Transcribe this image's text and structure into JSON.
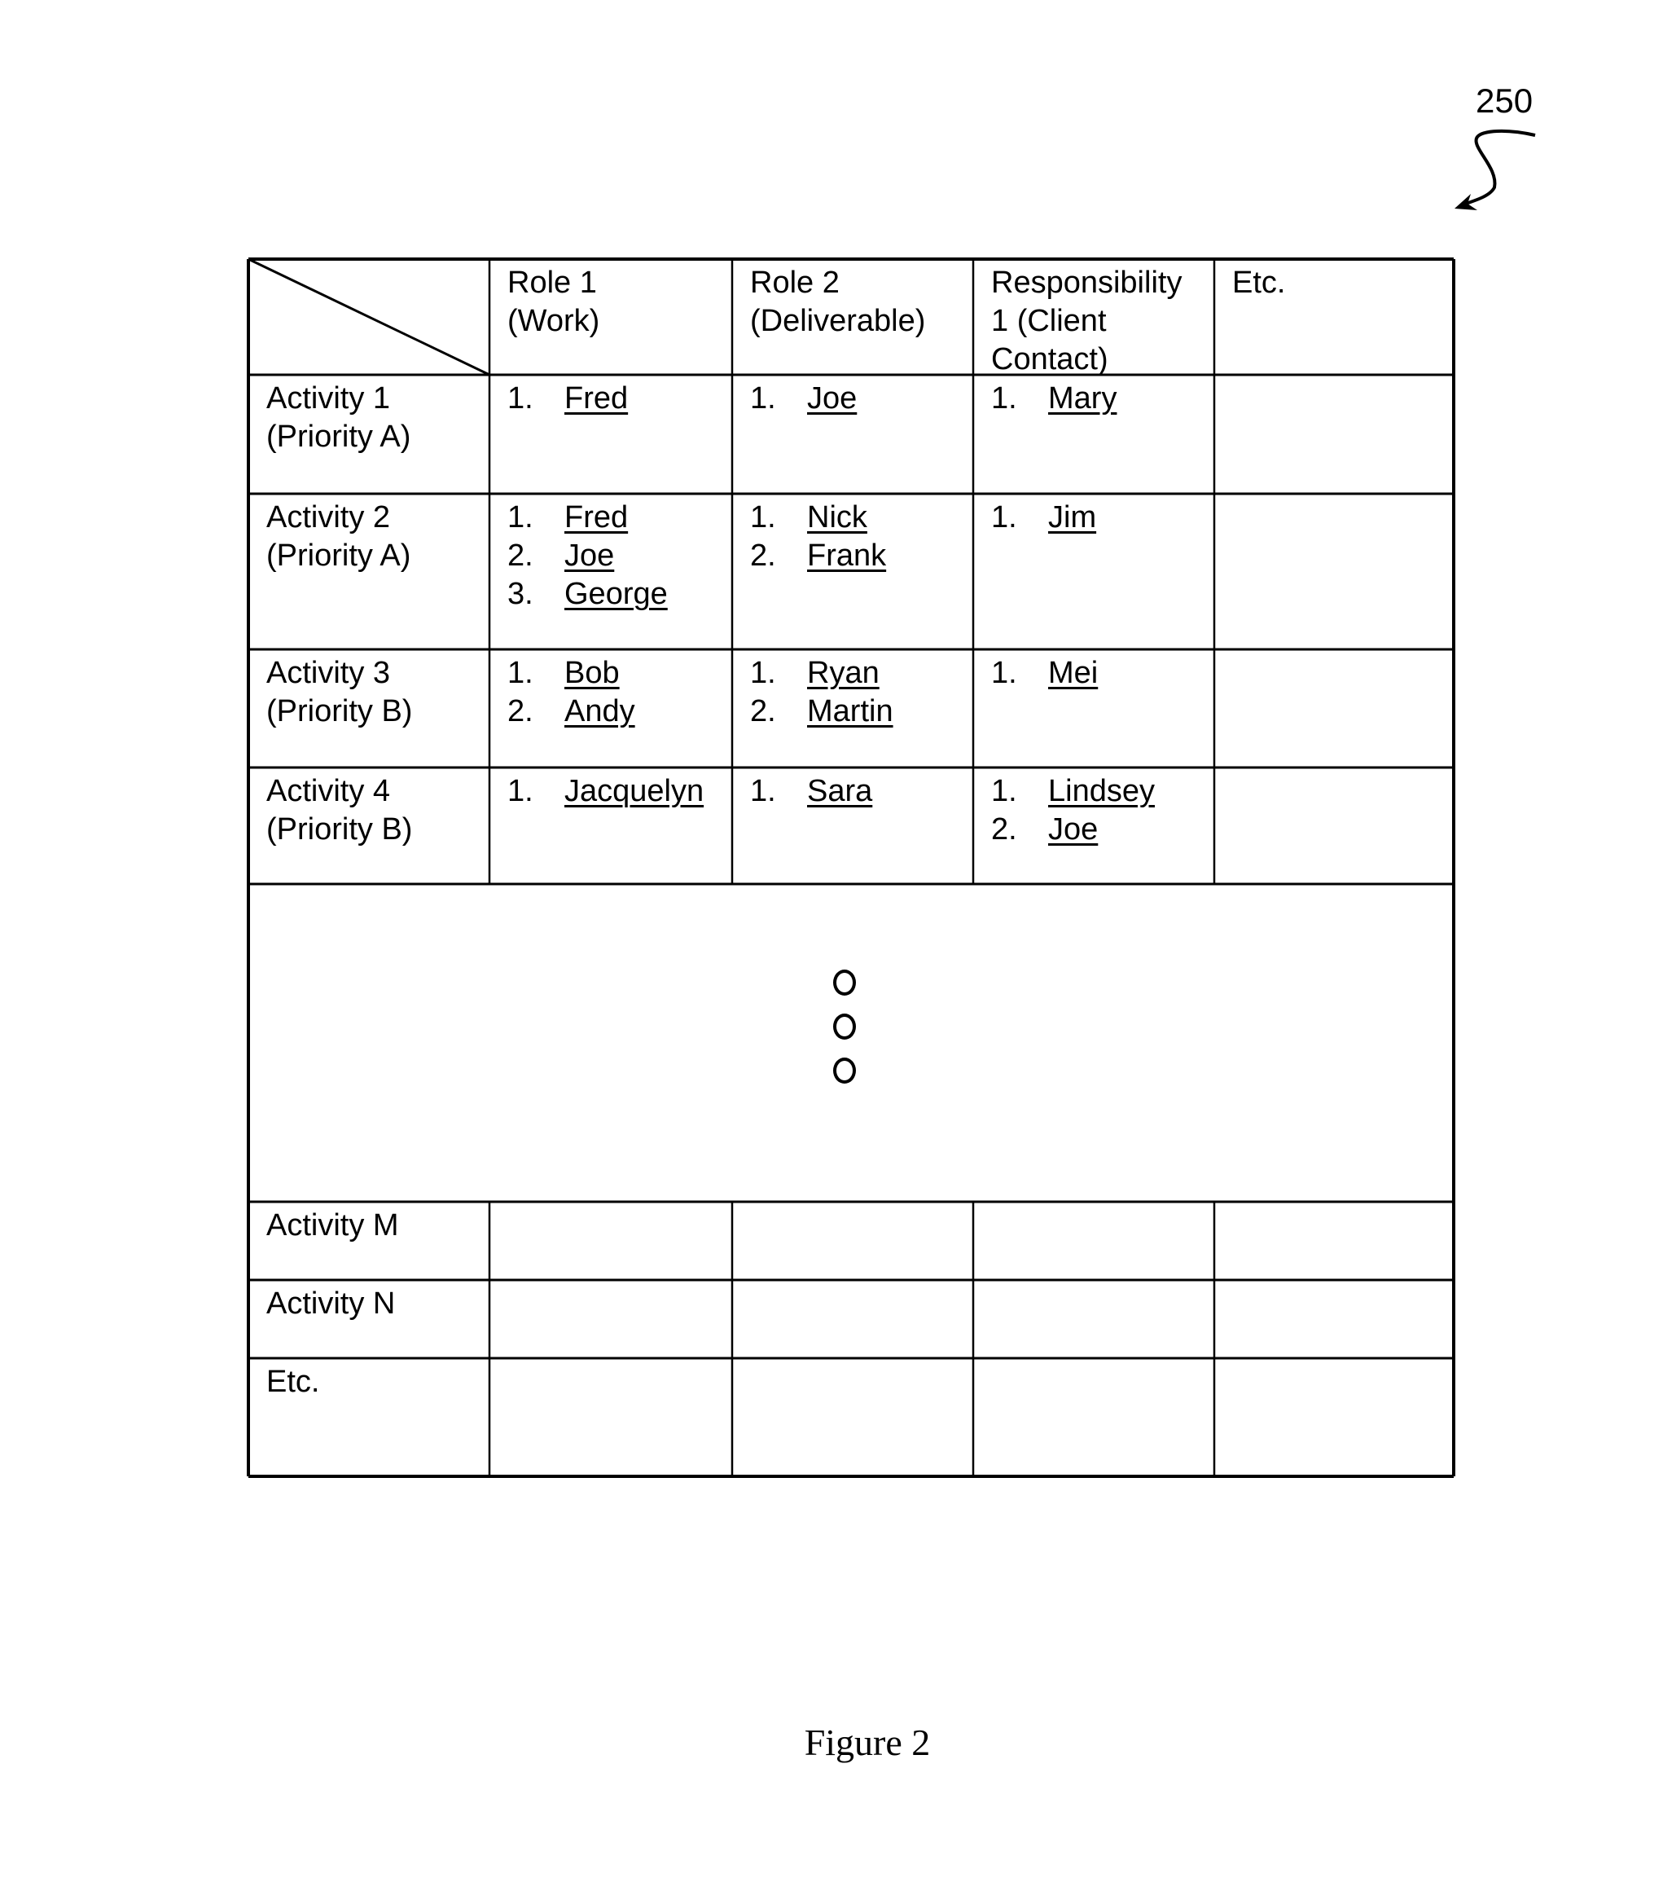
{
  "figure": {
    "reference_number": "250",
    "caption": "Figure 2",
    "ref_arrow_icon": "curved-arrow-icon"
  },
  "table": {
    "corner_icon": "diagonal-slash",
    "columns": [
      {
        "label": "Role 1\n(Work)",
        "lines": [
          "Role 1",
          "(Work)"
        ]
      },
      {
        "label": "Role 2\n(Deliverable)",
        "lines": [
          "Role 2",
          "(Deliverable)"
        ]
      },
      {
        "label": "Responsibility 1 (Client Contact)",
        "lines": [
          "Responsibility",
          "1 (Client",
          "Contact)"
        ]
      },
      {
        "label": "Etc.",
        "lines": [
          "Etc."
        ]
      }
    ],
    "rows": [
      {
        "lines": [
          "Activity 1",
          "(Priority A)"
        ],
        "cells": [
          [
            "Fred"
          ],
          [
            "Joe"
          ],
          [
            "Mary"
          ],
          []
        ]
      },
      {
        "lines": [
          "Activity 2",
          "(Priority A)"
        ],
        "cells": [
          [
            "Fred",
            "Joe",
            "George"
          ],
          [
            "Nick",
            "Frank"
          ],
          [
            "Jim"
          ],
          []
        ]
      },
      {
        "lines": [
          "Activity 3",
          "(Priority B)"
        ],
        "cells": [
          [
            "Bob",
            "Andy"
          ],
          [
            "Ryan",
            "Martin"
          ],
          [
            "Mei"
          ],
          []
        ]
      },
      {
        "lines": [
          "Activity 4",
          "(Priority B)"
        ],
        "cells": [
          [
            "Jacquelyn"
          ],
          [
            "Sara"
          ],
          [
            "Lindsey",
            "Joe"
          ],
          []
        ]
      }
    ],
    "ellipsis_icon": "vertical-ellipsis-circles",
    "tail_rows": [
      {
        "lines": [
          "Activity M"
        ],
        "cells": [
          [],
          [],
          [],
          []
        ]
      },
      {
        "lines": [
          "Activity N"
        ],
        "cells": [
          [],
          [],
          [],
          []
        ]
      },
      {
        "lines": [
          "Etc."
        ],
        "cells": [
          [],
          [],
          [],
          []
        ]
      }
    ]
  }
}
